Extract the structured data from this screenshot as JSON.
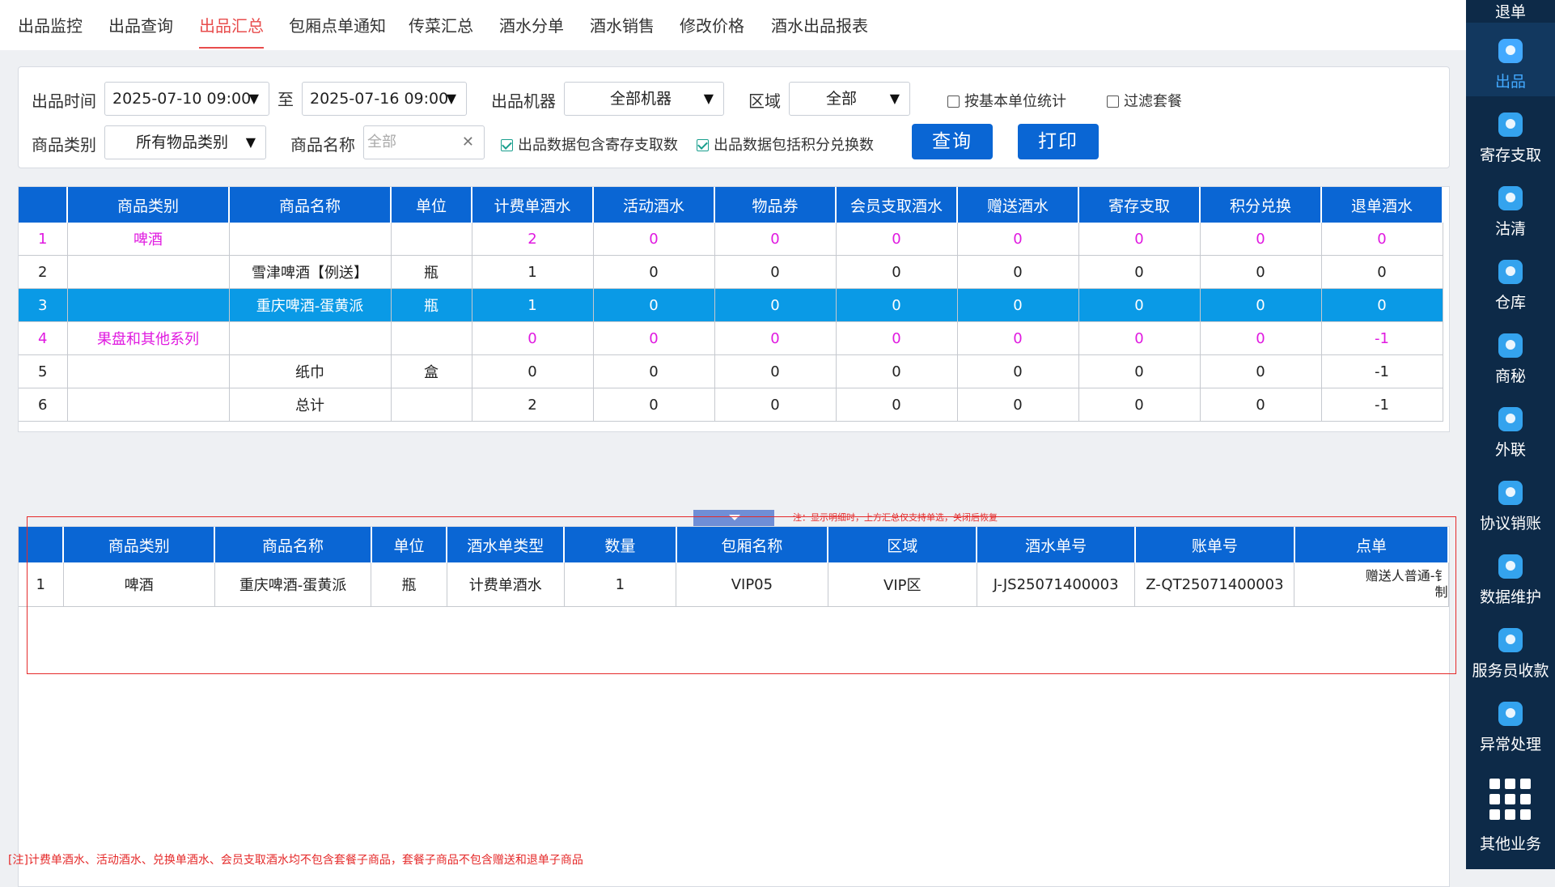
{
  "topnav": {
    "tabs": [
      "出品监控",
      "出品查询",
      "出品汇总",
      "包厢点单通知",
      "传菜汇总",
      "酒水分单",
      "酒水销售",
      "修改价格",
      "酒水出品报表"
    ],
    "active_index": 2
  },
  "filter": {
    "time_label": "出品时间",
    "start_time": "2025-07-10 09:00",
    "to_label": "至",
    "end_time": "2025-07-16 09:00",
    "machine_label": "出品机器",
    "machine_value": "全部机器",
    "area_label": "区域",
    "area_value": "全部",
    "base_unit_label": "按基本单位统计",
    "filter_combo_label": "过滤套餐",
    "category_label": "商品类别",
    "category_value": "所有物品类别",
    "name_label": "商品名称",
    "name_placeholder": "全部",
    "include_storage_label": "出品数据包含寄存支取数",
    "include_points_label": "出品数据包括积分兑换数",
    "query_button": "查询",
    "print_button": "打印"
  },
  "summary_table": {
    "headers": [
      "",
      "商品类别",
      "商品名称",
      "单位",
      "计费单酒水",
      "活动酒水",
      "物品券",
      "会员支取酒水",
      "赠送酒水",
      "寄存支取",
      "积分兑换",
      "退单酒水"
    ],
    "rows": [
      {
        "idx": "1",
        "category": "啤酒",
        "name": "",
        "unit": "",
        "vals": [
          "2",
          "0",
          "0",
          "0",
          "0",
          "0",
          "0",
          "0"
        ],
        "style": "pink"
      },
      {
        "idx": "2",
        "category": "",
        "name": "雪津啤酒【例送】",
        "unit": "瓶",
        "vals": [
          "1",
          "0",
          "0",
          "0",
          "0",
          "0",
          "0",
          "0"
        ],
        "style": ""
      },
      {
        "idx": "3",
        "category": "",
        "name": "重庆啤酒-蛋黄派",
        "unit": "瓶",
        "vals": [
          "1",
          "0",
          "0",
          "0",
          "0",
          "0",
          "0",
          "0"
        ],
        "style": "sel-row"
      },
      {
        "idx": "4",
        "category": "果盘和其他系列",
        "name": "",
        "unit": "",
        "vals": [
          "0",
          "0",
          "0",
          "0",
          "0",
          "0",
          "0",
          "-1"
        ],
        "style": "pink"
      },
      {
        "idx": "5",
        "category": "",
        "name": "纸巾",
        "unit": "盒",
        "vals": [
          "0",
          "0",
          "0",
          "0",
          "0",
          "0",
          "0",
          "-1"
        ],
        "style": ""
      },
      {
        "idx": "6",
        "category": "",
        "name": "总计",
        "unit": "",
        "vals": [
          "2",
          "0",
          "0",
          "0",
          "0",
          "0",
          "0",
          "-1"
        ],
        "style": ""
      }
    ]
  },
  "note_detail": "注：显示明细时，上方汇总仅支持单选，关闭后恢复",
  "detail_table": {
    "headers": [
      "",
      "商品类别",
      "商品名称",
      "单位",
      "酒水单类型",
      "数量",
      "包厢名称",
      "区域",
      "酒水单号",
      "账单号",
      "点单"
    ],
    "rows": [
      {
        "idx": "1",
        "category": "啤酒",
        "name": "重庆啤酒-蛋黄派",
        "unit": "瓶",
        "type": "计费单酒水",
        "qty": "1",
        "room": "VIP05",
        "area": "VIP区",
        "drink_no": "J-JS25071400003",
        "bill_no": "Z-QT25071400003",
        "orderer_line1": "赠送人普通-钅",
        "orderer_line2": "制"
      }
    ]
  },
  "footnote": "[注]计费单酒水、活动酒水、兑换单酒水、会员支取酒水均不包含套餐子商品，套餐子商品不包含赠送和退单子商品",
  "sidebar": {
    "top_item": "退单",
    "items": [
      "出品",
      "寄存支取",
      "沽清",
      "仓库",
      "商秘",
      "外联",
      "协议销账",
      "数据维护",
      "服务员收款",
      "异常处理"
    ],
    "active_index": 0,
    "bottom_item": "其他业务"
  },
  "colors": {
    "header_blue": "#0a66d4",
    "selected_row": "#0a9ae6",
    "pink_text": "#e01ae0",
    "active_tab": "#e84d4d",
    "sidebar_bg": "#0d2a48"
  }
}
